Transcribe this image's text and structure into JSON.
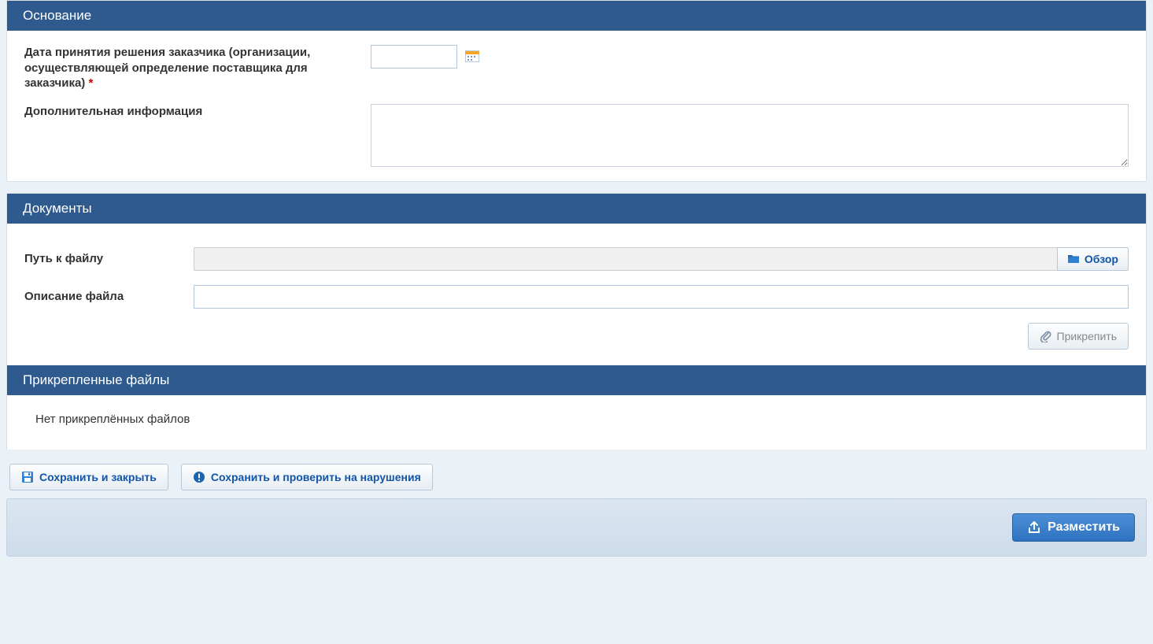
{
  "basis": {
    "header": "Основание",
    "date_label": "Дата принятия решения заказчика (организации, осуществляющей определение поставщика для заказчика)",
    "required_mark": "*",
    "date_value": "",
    "info_label": "Дополнительная информация",
    "info_value": ""
  },
  "documents": {
    "header": "Документы",
    "path_label": "Путь к файлу",
    "path_value": "",
    "browse_label": "Обзор",
    "desc_label": "Описание файла",
    "desc_value": "",
    "attach_label": "Прикрепить"
  },
  "attached": {
    "header": "Прикрепленные файлы",
    "empty_text": "Нет прикреплённых файлов"
  },
  "actions": {
    "save_close": "Сохранить и закрыть",
    "save_check": "Сохранить и проверить на нарушения",
    "publish": "Разместить"
  }
}
